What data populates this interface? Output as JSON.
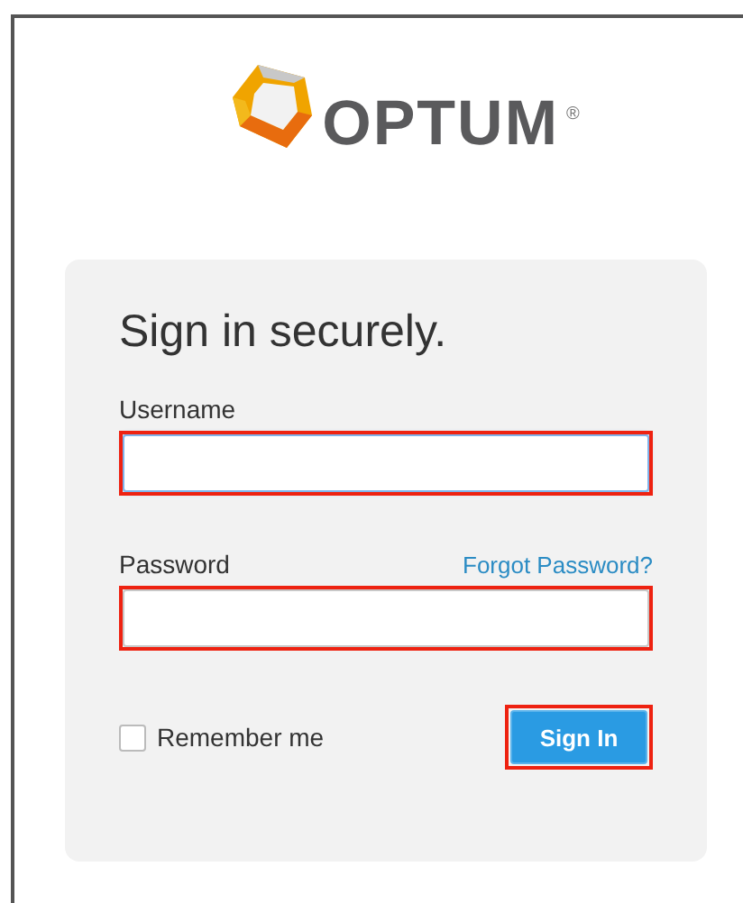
{
  "logo": {
    "wordmark": "OPTUM",
    "mark": "®"
  },
  "form": {
    "title": "Sign in securely.",
    "fields": [
      {
        "label": "Username",
        "focused": true,
        "highlighted": true
      },
      {
        "label": "Password",
        "focused": false,
        "highlighted": true,
        "link": "Forgot Password?"
      }
    ],
    "remember": {
      "label": "Remember me",
      "checked": false
    },
    "submit": {
      "label": "Sign In",
      "highlighted": true
    }
  }
}
